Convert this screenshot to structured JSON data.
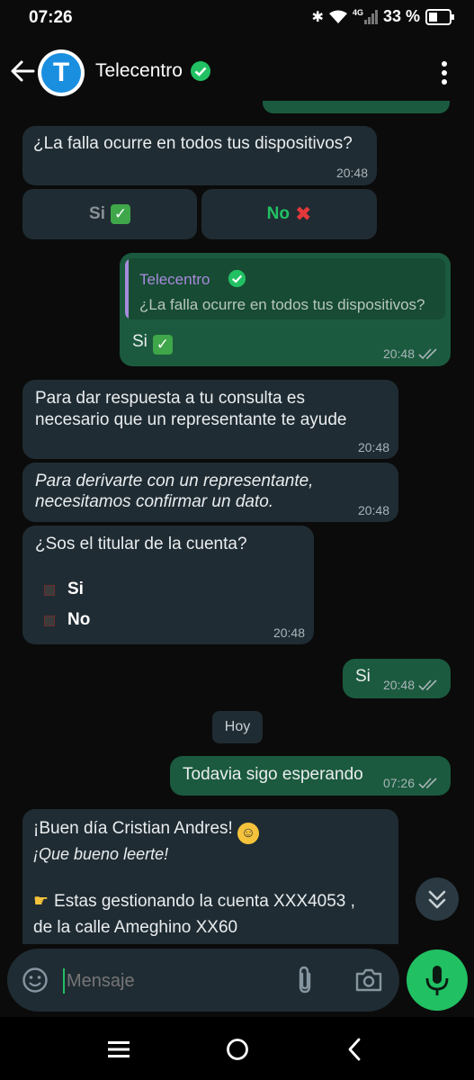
{
  "status": {
    "time": "07:26",
    "battery": "33 %",
    "network": "4G"
  },
  "header": {
    "title": "Telecentro",
    "avatar_letter": "T"
  },
  "messages": {
    "m1": {
      "text": "¿La falla ocurre en todos tus dispositivos?",
      "time": "20:48"
    },
    "m1_buttons": {
      "si": "Si",
      "no": "No"
    },
    "m2": {
      "quote_author": "Telecentro",
      "quote_text": "¿La falla ocurre en todos tus dispositivos?",
      "text": "Si",
      "time": "20:48"
    },
    "m3": {
      "line1": "Para dar respuesta a tu consulta es",
      "line2": "necesario que un representante te ayude",
      "time": "20:48"
    },
    "m4": {
      "line1": "Para derivarte con un representante,",
      "line2": "necesitamos confirmar un dato.",
      "time": "20:48"
    },
    "m5": {
      "text": "¿Sos el titular de la cuenta?",
      "opt1": "Si",
      "opt2": "No",
      "time": "20:48"
    },
    "m6": {
      "text": "Si",
      "time": "20:48"
    },
    "date_chip": "Hoy",
    "m7": {
      "text": "Todavia sigo esperando",
      "time": "07:26"
    },
    "m8": {
      "line1": "¡Buen día Cristian Andres!",
      "line2": "¡Que bueno leerte!",
      "line3": "Estas gestionando la cuenta XXX4053 ,",
      "line4": "de la calle Ameghino  XX60"
    }
  },
  "input": {
    "placeholder": "Mensaje"
  },
  "colors": {
    "accent_green": "#21c063",
    "incoming": "#202c33",
    "outgoing": "#1b5a3e",
    "quote_purple": "#a78bdb"
  }
}
